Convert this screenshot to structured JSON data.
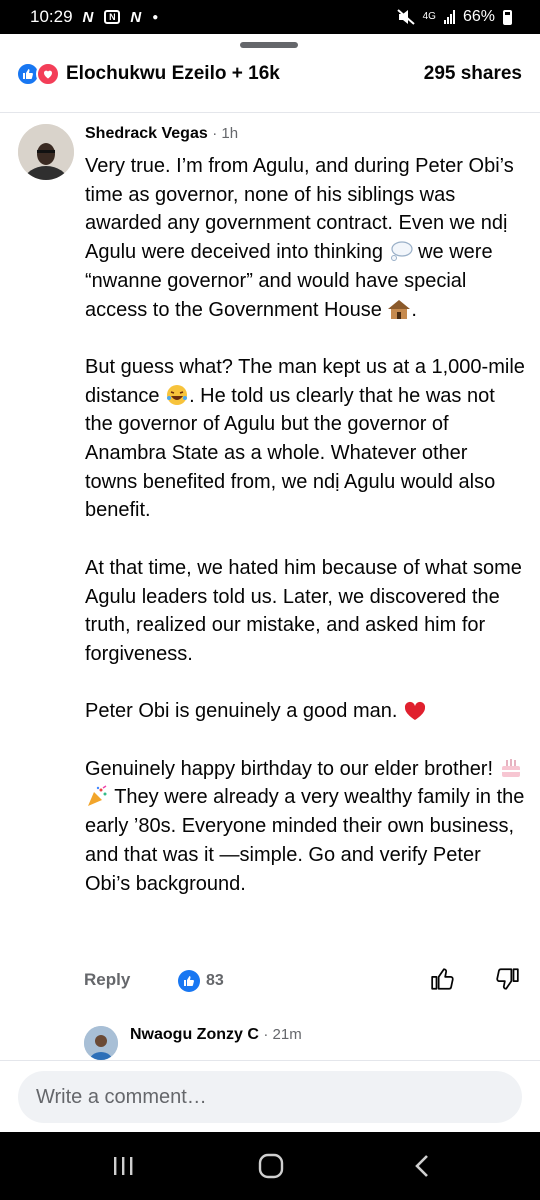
{
  "status_bar": {
    "time": "10:29",
    "network": "4G",
    "battery": "66%"
  },
  "reactions": {
    "names": "Elochukwu Ezeilo + 16k",
    "shares": "295 shares",
    "like_color": "#1877f2",
    "love_color": "#f33e58"
  },
  "comment": {
    "author": "Shedrack Vegas",
    "time": "· 1h",
    "paragraphs": {
      "p1": "Very true. I’m from Agulu, and during Peter Obi’s time as governor, none of his siblings was awarded any government contract. Even we ndị Agulu were deceived into thinking",
      "p1b": "we were “nwanne governor” and would have special access to the Government House",
      "p1c": ".",
      "p2a": "But guess what? The man kept us at a 1,000-mile distance",
      "p2b": ". He told us clearly that he was not the governor of Agulu but the governor of Anambra State as a whole. Whatever other towns benefited from, we ndị Agulu would also benefit.",
      "p3": "At that time, we hated him because of what some Agulu leaders told us. Later, we discovered the truth, realized our mistake, and asked him for forgiveness.",
      "p4": "Peter Obi is genuinely a good man.",
      "p5a": "Genuinely happy birthday to our elder brother!",
      "p5b": "They were already a very wealthy family in the early ’80s. Everyone minded their own business, and that was it —simple. Go and verify Peter Obi’s background."
    },
    "reply_label": "Reply",
    "like_count": "83",
    "emoji_icons": [
      "thought-bubble-icon",
      "hut-icon",
      "laughing-emoji-icon",
      "heart-icon",
      "birthday-cake-icon",
      "party-popper-icon"
    ]
  },
  "reply_preview": {
    "author": "Nwaogu Zonzy C",
    "time": "· 21m"
  },
  "composer": {
    "placeholder": "Write a comment…"
  }
}
